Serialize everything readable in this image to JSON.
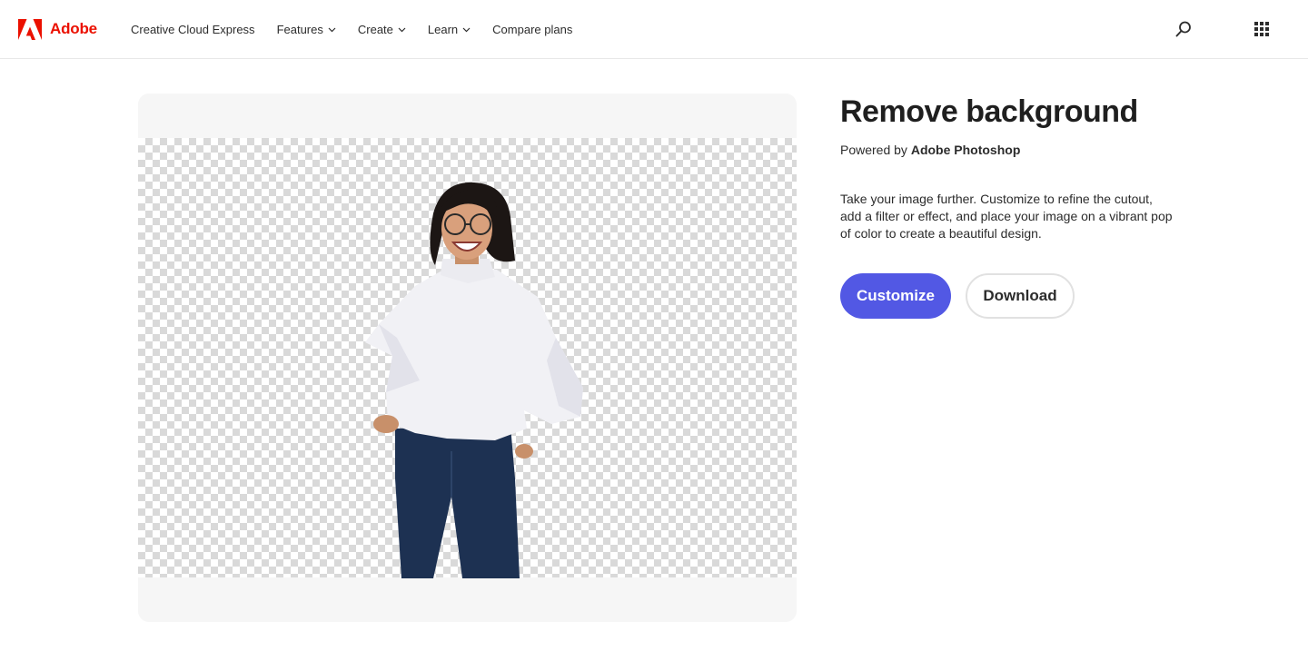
{
  "header": {
    "brand": "Adobe",
    "nav": [
      {
        "label": "Creative Cloud Express",
        "has_dropdown": false
      },
      {
        "label": "Features",
        "has_dropdown": true
      },
      {
        "label": "Create",
        "has_dropdown": true
      },
      {
        "label": "Learn",
        "has_dropdown": true
      },
      {
        "label": "Compare plans",
        "has_dropdown": false
      }
    ],
    "icons": {
      "search": "search-icon",
      "apps": "app-grid-icon",
      "logo": "adobe-logo-icon",
      "dropdown": "chevron-down-icon"
    }
  },
  "main": {
    "title": "Remove background",
    "powered_prefix": "Powered by",
    "powered_product": "Adobe Photoshop",
    "description": "Take your image further. Customize to refine the cutout, add a filter or effect, and place your image on a vibrant pop of color to create a beautiful design.",
    "buttons": {
      "customize": "Customize",
      "download": "Download"
    }
  },
  "colors": {
    "brand": "#eb1000",
    "primary_button": "#5258e4",
    "card_bg": "#f6f6f6",
    "checker": "#d9d9d9"
  }
}
